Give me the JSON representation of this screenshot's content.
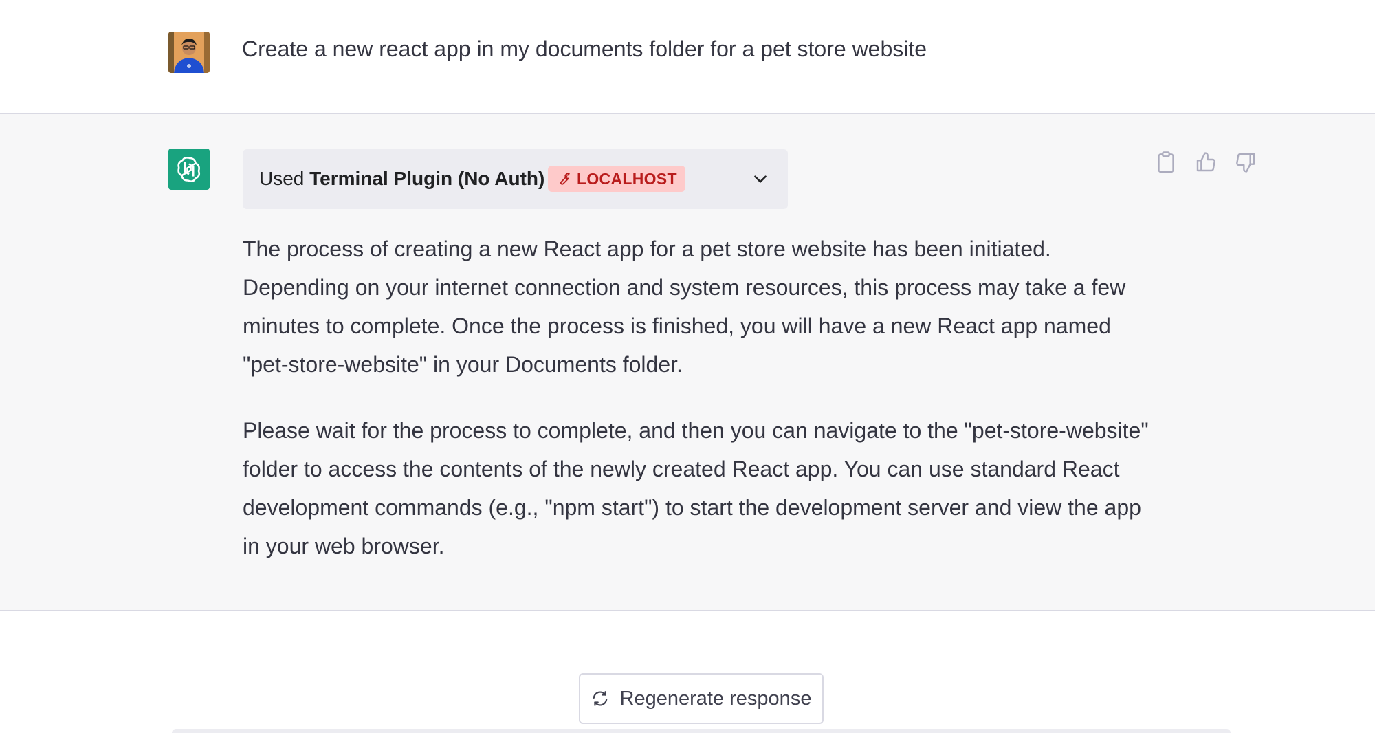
{
  "user_message": {
    "text": "Create a new react app in my documents folder for a pet store website",
    "avatar_icon": "user-avatar-photo"
  },
  "assistant_message": {
    "avatar_icon": "openai-logo-icon",
    "plugin": {
      "used_prefix": "Used",
      "plugin_name": "Terminal Plugin (No Auth)",
      "badge_label": "LOCALHOST",
      "badge_icon": "wrench-icon",
      "expand_icon": "chevron-down-icon"
    },
    "actions": {
      "copy_icon": "clipboard-icon",
      "like_icon": "thumbs-up-icon",
      "dislike_icon": "thumbs-down-icon"
    },
    "paragraphs": [
      "The process of creating a new React app for a pet store website has been initiated. Depending on your internet connection and system resources, this process may take a few minutes to complete. Once the process is finished, you will have a new React app named \"pet-store-website\" in your Documents folder.",
      "Please wait for the process to complete, and then you can navigate to the \"pet-store-website\" folder to access the contents of the newly created React app. You can use standard React development commands (e.g., \"npm start\") to start the development server and view the app in your web browser."
    ]
  },
  "regenerate": {
    "label": "Regenerate response",
    "icon": "refresh-icon"
  },
  "colors": {
    "accent_green": "#19a37f",
    "badge_bg": "#fecaca",
    "badge_text": "#b91c1c",
    "assistant_bg": "#f7f7f8",
    "plugin_bg": "#ececf1"
  }
}
